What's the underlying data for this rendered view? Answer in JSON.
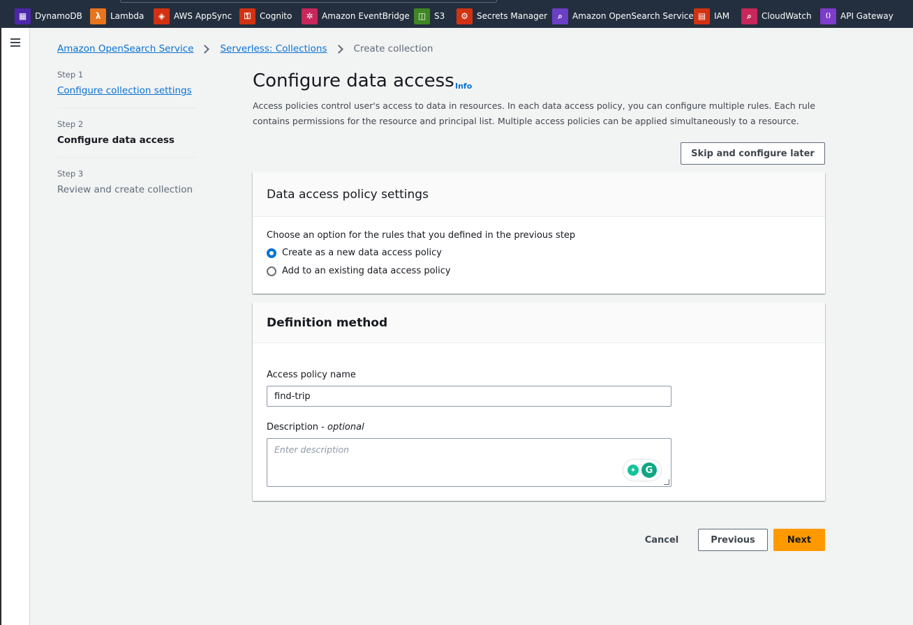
{
  "favorites": [
    {
      "label": "DynamoDB",
      "icon": "dynamodb-icon",
      "color": "#4d27aa",
      "glyph": "▦"
    },
    {
      "label": "Lambda",
      "icon": "lambda-icon",
      "color": "#e8741c",
      "glyph": "λ"
    },
    {
      "label": "AWS AppSync",
      "icon": "appsync-icon",
      "color": "#d13212",
      "glyph": "◈"
    },
    {
      "label": "Cognito",
      "icon": "cognito-icon",
      "color": "#d13212",
      "glyph": "⚿"
    },
    {
      "label": "Amazon EventBridge",
      "icon": "eventbridge-icon",
      "color": "#c7275b",
      "glyph": "✲"
    },
    {
      "label": "S3",
      "icon": "s3-icon",
      "color": "#3f8624",
      "glyph": "◫"
    },
    {
      "label": "Secrets Manager",
      "icon": "secrets-manager-icon",
      "color": "#d13212",
      "glyph": "⚙"
    },
    {
      "label": "Amazon OpenSearch Service",
      "icon": "opensearch-icon",
      "color": "#6b3fc4",
      "glyph": "⌕"
    },
    {
      "label": "IAM",
      "icon": "iam-icon",
      "color": "#d13212",
      "glyph": "▤"
    },
    {
      "label": "CloudWatch",
      "icon": "cloudwatch-icon",
      "color": "#c7275b",
      "glyph": "⌕"
    },
    {
      "label": "API Gateway",
      "icon": "api-gateway-icon",
      "color": "#7d3cc9",
      "glyph": "⟨⟩"
    }
  ],
  "breadcrumb": {
    "items": [
      "Amazon OpenSearch Service",
      "Serverless: Collections"
    ],
    "current": "Create collection"
  },
  "steps": [
    {
      "num": "Step 1",
      "title": "Configure collection settings"
    },
    {
      "num": "Step 2",
      "title": "Configure data access"
    },
    {
      "num": "Step 3",
      "title": "Review and create collection"
    }
  ],
  "page": {
    "title": "Configure data access",
    "info": "Info",
    "description": "Access policies control user's access to data in resources. In each data access policy, you can configure multiple rules. Each rule contains permissions for the resource and principal list. Multiple access policies can be applied simultaneously to a resource.",
    "skip_button": "Skip and configure later"
  },
  "policy_settings": {
    "header": "Data access policy settings",
    "prompt": "Choose an option for the rules that you defined in the previous step",
    "options": [
      "Create as a new data access policy",
      "Add to an existing data access policy"
    ],
    "selected": 0
  },
  "definition": {
    "header": "Definition method",
    "name_label": "Access policy name",
    "name_value": "find-trip",
    "desc_label": "Description",
    "desc_optional": "optional",
    "desc_placeholder": "Enter description"
  },
  "footer": {
    "cancel": "Cancel",
    "previous": "Previous",
    "next": "Next"
  },
  "colors": {
    "link": "#0972d3",
    "primary": "#ff9900",
    "topbar": "#232f3e"
  }
}
